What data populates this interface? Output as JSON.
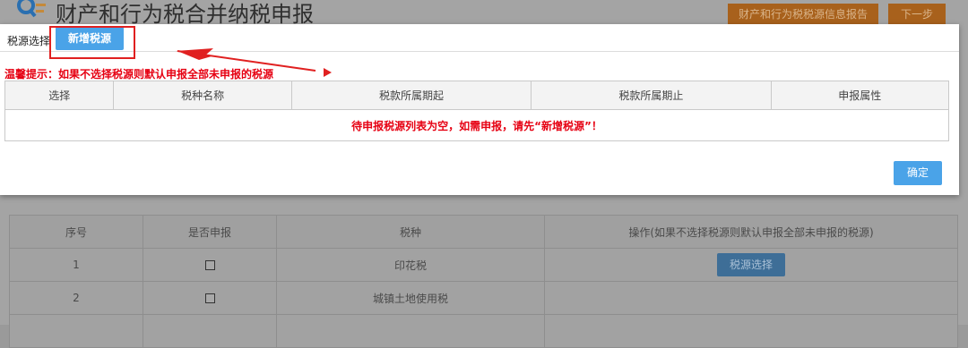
{
  "colors": {
    "accent_blue": "#4aa3e8",
    "warning_red": "#e60012",
    "annotation_red": "#e02020",
    "report_orange": "#a8611c"
  },
  "background": {
    "title": "财产和行为税合并纳税申报",
    "logo_icon": "magnifier-list-icon",
    "buttons": {
      "report": "财产和行为税税源信息报告",
      "next": "下一步"
    },
    "table": {
      "headers": [
        "序号",
        "是否申报",
        "税种",
        "操作(如果不选择税源则默认申报全部未申报的税源)"
      ],
      "rows": [
        {
          "index": "1",
          "tax_type": "印花税",
          "action_label": "税源选择"
        },
        {
          "index": "2",
          "tax_type": "城镇土地使用税",
          "action_label": ""
        }
      ]
    }
  },
  "modal": {
    "tab_label": "税源选择",
    "new_source_button": "新增税源",
    "tip": "温馨提示：如果不选择税源则默认申报全部未申报的税源",
    "table": {
      "headers": [
        "选择",
        "税种名称",
        "税款所属期起",
        "税款所属期止",
        "申报属性"
      ],
      "empty_message": "待申报税源列表为空，如需申报，请先“新增税源”！"
    },
    "confirm_button": "确定"
  }
}
